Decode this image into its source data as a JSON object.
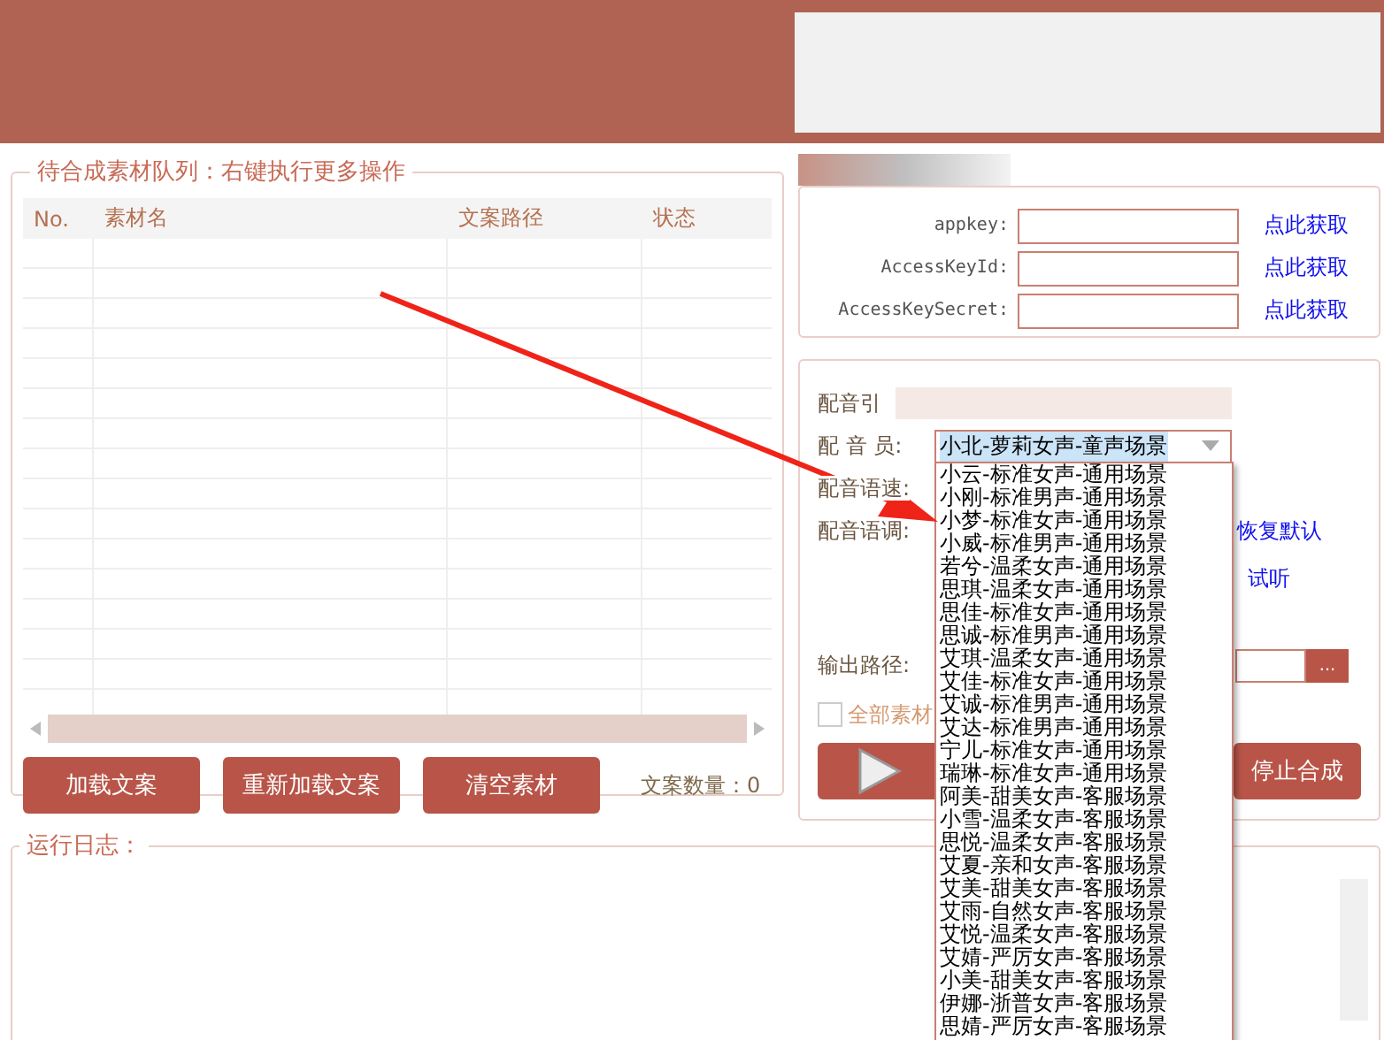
{
  "queue": {
    "title": "待合成素材队列：右键执行更多操作",
    "columns": [
      "No.",
      "素材名",
      "文案路径",
      "状态"
    ],
    "buttons": [
      "加载文案",
      "重新加载文案",
      "清空素材"
    ],
    "count": "文案数量：0"
  },
  "credentials": [
    {
      "label": "appkey:",
      "link": "点此获取"
    },
    {
      "label": "AccessKeyId:",
      "link": "点此获取"
    },
    {
      "label": "AccessKeySecret:",
      "link": "点此获取"
    }
  ],
  "settings": {
    "engine_label": "配音引",
    "voice_label": "配 音 员:",
    "voice_value": "小北-萝莉女声-童声场景",
    "speed_label": "配音语速:",
    "pitch_label": "配音语调:",
    "reset_link": "恢复默认",
    "listen_link": "试听",
    "output_label": "输出路径:",
    "browse_button": "...",
    "all_checkbox": {
      "label": "全部素材",
      "checked": false
    },
    "stop_button": "停止合成"
  },
  "voice_options": [
    "小云-标准女声-通用场景",
    "小刚-标准男声-通用场景",
    "小梦-标准女声-通用场景",
    "小威-标准男声-通用场景",
    "若兮-温柔女声-通用场景",
    "思琪-温柔女声-通用场景",
    "思佳-标准女声-通用场景",
    "思诚-标准男声-通用场景",
    "艾琪-温柔女声-通用场景",
    "艾佳-标准女声-通用场景",
    "艾诚-标准男声-通用场景",
    "艾达-标准男声-通用场景",
    "宁儿-标准女声-通用场景",
    "瑞琳-标准女声-通用场景",
    "阿美-甜美女声-客服场景",
    "小雪-温柔女声-客服场景",
    "思悦-温柔女声-客服场景",
    "艾夏-亲和女声-客服场景",
    "艾美-甜美女声-客服场景",
    "艾雨-自然女声-客服场景",
    "艾悦-温柔女声-客服场景",
    "艾婧-严厉女声-客服场景",
    "小美-甜美女声-客服场景",
    "伊娜-浙普女声-客服场景",
    "思婧-严厉女声-客服场景"
  ],
  "log": {
    "title": "运行日志："
  }
}
